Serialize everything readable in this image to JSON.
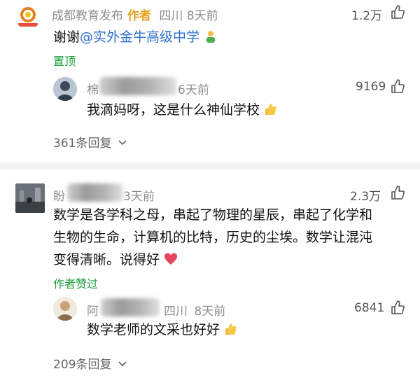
{
  "comment1": {
    "author": "成都教育发布",
    "author_tag": "作者",
    "location": "四川",
    "time": "8天前",
    "likes": "1.2万",
    "text_prefix": "谢谢",
    "mention": "@实外金牛高级中学",
    "pinned": "置顶",
    "avatar_caption": "成都教育发布"
  },
  "reply1": {
    "author_visible": "棉",
    "time": "6天前",
    "likes": "9169",
    "text": "我滴妈呀，这是什么神仙学校"
  },
  "replies1": {
    "label": "361条回复"
  },
  "comment2": {
    "author_visible": "盼",
    "time": "3天前",
    "likes": "2.3万",
    "line1": "数学是各学科之母，串起了物理的星辰，串起了化学和",
    "line2": "生物的生命，计算机的比特，历史的尘埃。数学让混沌",
    "line3": "变得清晰。说得好",
    "author_liked": "作者赞过"
  },
  "reply2": {
    "author_visible": "阿",
    "location": "四川",
    "time": "8天前",
    "likes": "6841",
    "text": "数学老师的文采也好好"
  },
  "replies2": {
    "label": "209条回复"
  },
  "icons": {
    "like": "thumbs-up-outline-icon",
    "chevron": "chevron-down-icon",
    "thumbs_emoji": "thumbs-up-emoji",
    "heart_emoji": "heart-emoji",
    "person_emoji": "person-emoji"
  },
  "colors": {
    "accent_green": "#1a9e3c",
    "author_tag": "#e0a21a",
    "mention": "#2f6fd0",
    "heart": "#e8455e"
  }
}
